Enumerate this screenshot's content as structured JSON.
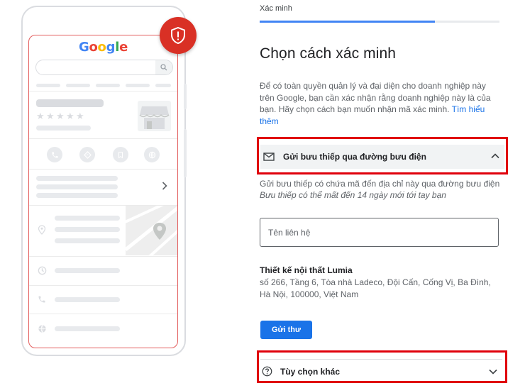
{
  "illustration": {
    "google_logo_letters": [
      "G",
      "o",
      "o",
      "g",
      "l",
      "e"
    ],
    "rating_stars": [
      "★",
      "★",
      "★",
      "★",
      "★"
    ]
  },
  "header": {
    "step_label": "Xác minh",
    "progress_fraction": 0.73
  },
  "main": {
    "title": "Chọn cách xác minh",
    "intro_text": "Để có toàn quyền quản lý và đại diện cho doanh nghiệp này trên Google, bạn cần xác nhận rằng doanh nghiệp này là của bạn. Hãy chọn cách bạn muốn nhận mã xác minh.",
    "learn_more_link": "Tìm hiểu thêm"
  },
  "postcard_option": {
    "label": "Gửi bưu thiếp qua đường bưu điện",
    "description": "Gửi bưu thiếp có chứa mã đến địa chỉ này qua đường bưu điện",
    "delivery_note": "Bưu thiếp có thể mất đến 14 ngày mới tới tay bạn",
    "contact_placeholder": "Tên liên hệ",
    "business_name": "Thiết kế nội thất Lumia",
    "business_address": "số 266, Tầng 6, Tòa nhà Ladeco, Đội Cấn, Cống Vị, Ba Đình, Hà Nội, 100000, Việt Nam",
    "send_button": "Gửi thư"
  },
  "other_options": {
    "label": "Tùy chọn khác"
  },
  "colors": {
    "accent_blue": "#1a73e8",
    "highlight_red": "#e0000b",
    "shield_red": "#d93025"
  }
}
